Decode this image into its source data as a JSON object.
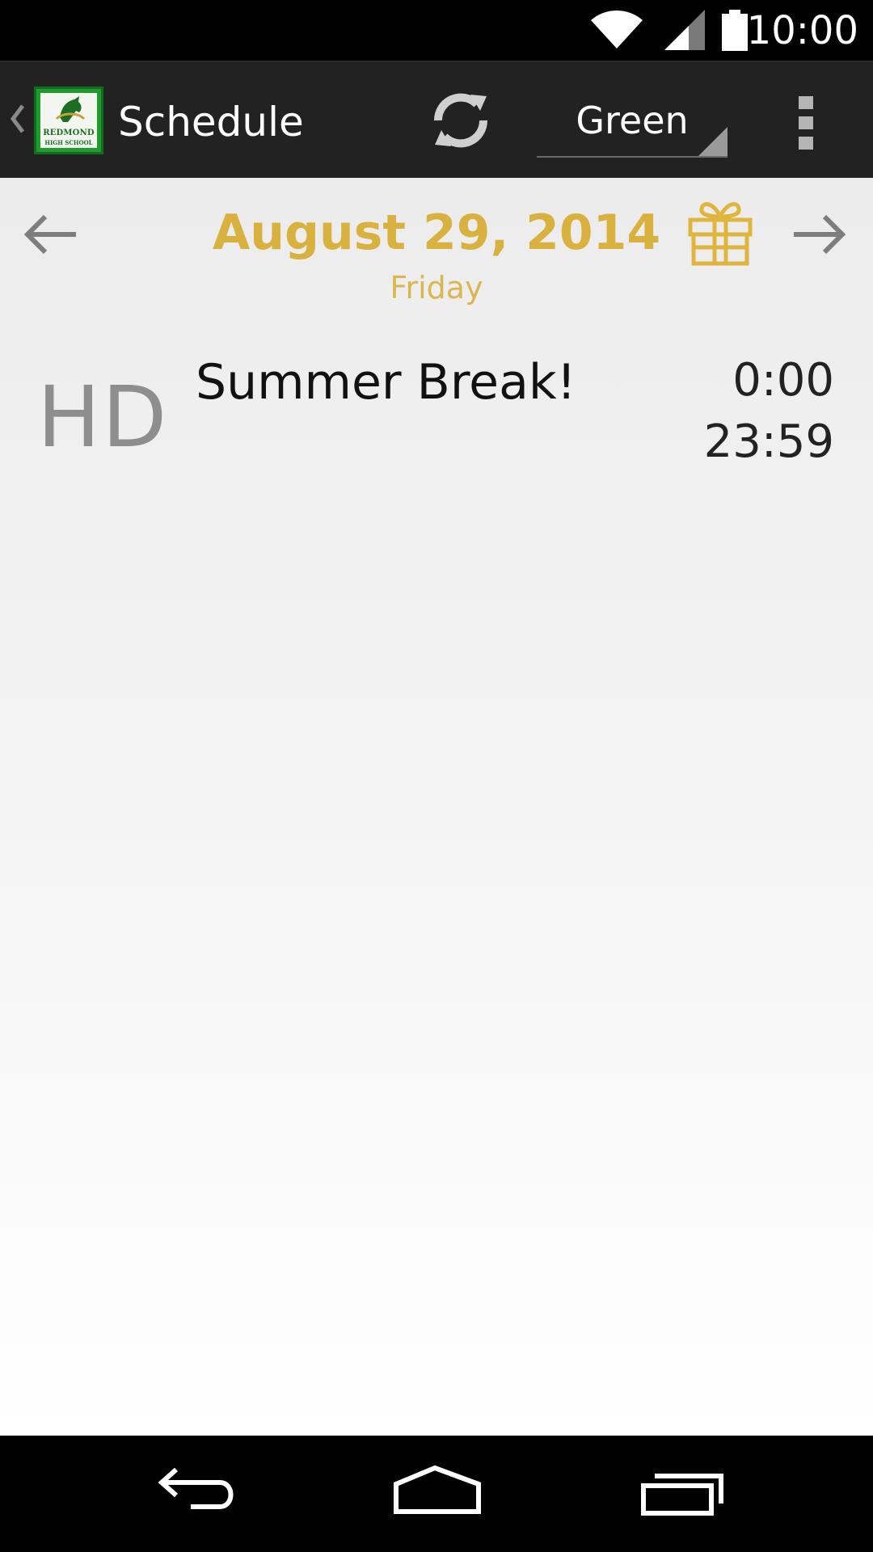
{
  "status_bar": {
    "time": "10:00",
    "icons": [
      "wifi-icon",
      "signal-icon",
      "battery-icon"
    ]
  },
  "action_bar": {
    "title": "Schedule",
    "logo": {
      "line1": "REDMOND",
      "line2": "HIGH SCHOOL"
    },
    "refresh_icon": "refresh-icon",
    "schedule_selector": {
      "selected": "Green"
    },
    "overflow_icon": "overflow-menu-icon"
  },
  "date_header": {
    "date": "August 29, 2014",
    "weekday": "Friday",
    "prev_icon": "arrow-left-icon",
    "next_icon": "arrow-right-icon",
    "gift_icon": "gift-icon"
  },
  "schedule": {
    "rows": [
      {
        "period": "HD",
        "name": "Summer Break!",
        "start": "0:00",
        "end": "23:59"
      }
    ]
  },
  "nav_bar": {
    "icons": [
      "back-icon",
      "home-icon",
      "recents-icon"
    ]
  },
  "colors": {
    "accent": "#d9b13f",
    "action_bar": "#222222",
    "logo_green": "#1f9a2c"
  }
}
